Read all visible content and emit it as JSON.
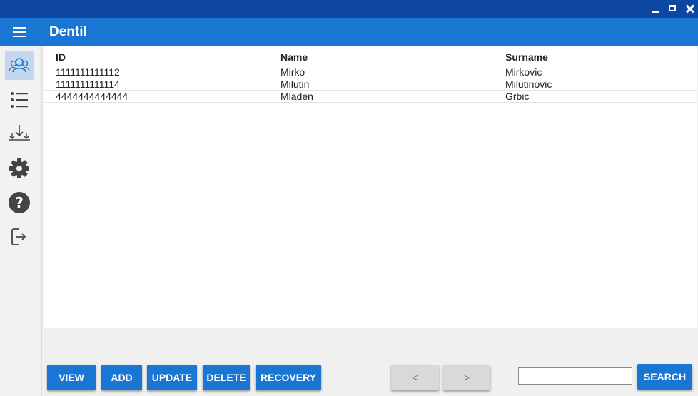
{
  "window": {
    "title_bar_color": "#0d47a1"
  },
  "appbar": {
    "title": "Dentil",
    "color": "#1976d2"
  },
  "sidebar": {
    "items": [
      {
        "name": "patients",
        "icon": "people-icon",
        "active": true
      },
      {
        "name": "list",
        "icon": "list-icon"
      },
      {
        "name": "import",
        "icon": "download-icon"
      },
      {
        "name": "settings",
        "icon": "gear-icon"
      },
      {
        "name": "help",
        "icon": "help-icon"
      },
      {
        "name": "logout",
        "icon": "logout-icon"
      }
    ]
  },
  "table": {
    "columns": [
      "ID",
      "Name",
      "Surname"
    ],
    "rows": [
      {
        "id": "1111111111112",
        "name": "Mirko",
        "surname": "Mirkovic"
      },
      {
        "id": "1111111111114",
        "name": "Milutin",
        "surname": "Milutinovic"
      },
      {
        "id": "4444444444444",
        "name": "Mladen",
        "surname": "Grbic"
      }
    ]
  },
  "actions": {
    "view": "VIEW",
    "add": "ADD",
    "update": "UPDATE",
    "delete": "DELETE",
    "recovery": "RECOVERY"
  },
  "pagination": {
    "prev": "<",
    "next": ">"
  },
  "search": {
    "value": "",
    "button": "SEARCH"
  }
}
